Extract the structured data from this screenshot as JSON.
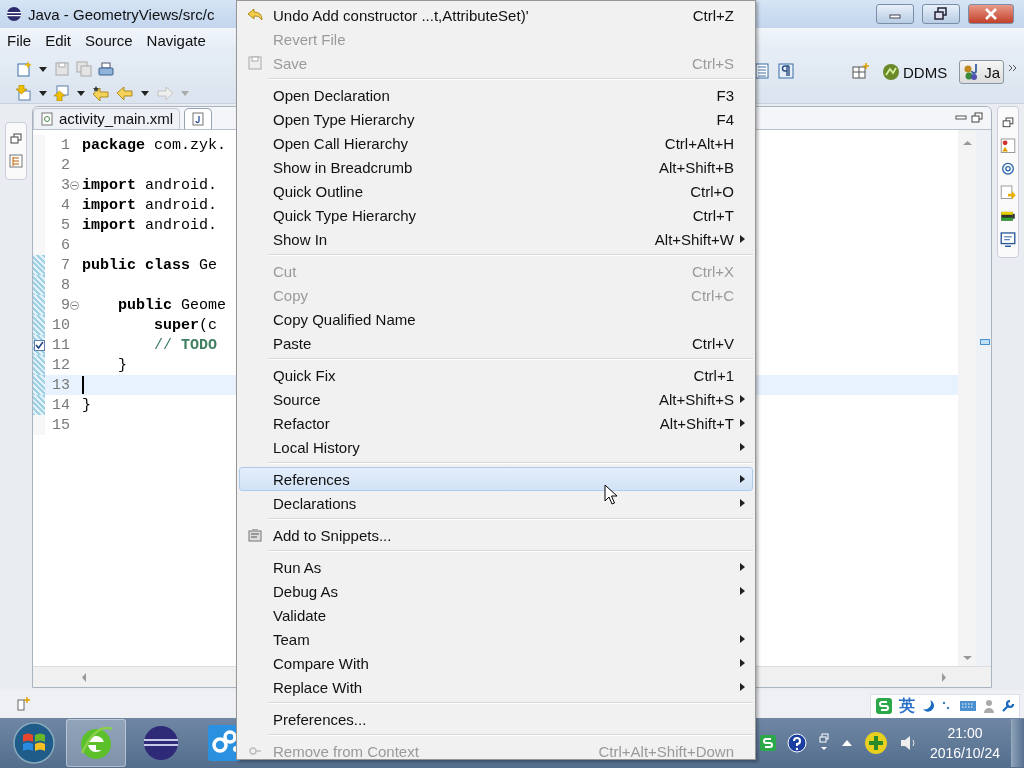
{
  "window": {
    "title": "Java - GeometryViews/src/c"
  },
  "menubar": [
    "File",
    "Edit",
    "Source",
    "Navigate"
  ],
  "perspectives": [
    {
      "label": "DDMS",
      "selected": false
    },
    {
      "label": "Ja",
      "selected": true
    }
  ],
  "editor": {
    "tabs": [
      {
        "label": "activity_main.xml",
        "selected": false
      },
      {
        "selected": true
      }
    ],
    "lines": [
      {
        "number": "1",
        "text": "**package** com.zyk.",
        "kind": "code",
        "folding": false,
        "task": false,
        "current": false,
        "changed": false
      },
      {
        "number": "2",
        "folding": false,
        "task": false,
        "current": false,
        "changed": false
      },
      {
        "number": "3",
        "text": "**import** android.",
        "kind": "code",
        "folding": true,
        "task": false,
        "current": false,
        "changed": false
      },
      {
        "number": "4",
        "text": "**import** android.",
        "kind": "code",
        "folding": false,
        "task": false,
        "current": false,
        "changed": false
      },
      {
        "number": "5",
        "text": "**import** android.",
        "kind": "code",
        "folding": false,
        "task": false,
        "current": false,
        "changed": false
      },
      {
        "number": "6",
        "folding": false,
        "task": false,
        "current": false,
        "changed": false
      },
      {
        "number": "7",
        "text": "**public class** Ge",
        "kind": "code",
        "folding": false,
        "task": false,
        "current": false,
        "changed": true
      },
      {
        "number": "8",
        "folding": false,
        "task": false,
        "current": false,
        "changed": true
      },
      {
        "number": "9",
        "text": "    **public** Geome",
        "kind": "code",
        "folding": true,
        "task": false,
        "current": false,
        "changed": true
      },
      {
        "number": "10",
        "text": "        **super**(c",
        "kind": "code",
        "folding": false,
        "task": false,
        "current": false,
        "changed": true
      },
      {
        "number": "11",
        "text": "        // **TODO**",
        "kind": "comment",
        "folding": false,
        "task": true,
        "current": false,
        "changed": true
      },
      {
        "number": "12",
        "text": "    }",
        "kind": "code",
        "folding": false,
        "task": false,
        "current": false,
        "changed": true
      },
      {
        "number": "13",
        "folding": false,
        "task": false,
        "current": true,
        "changed": true
      },
      {
        "number": "14",
        "text": "}",
        "kind": "code",
        "folding": false,
        "task": false,
        "current": false,
        "changed": true
      },
      {
        "number": "15",
        "folding": false,
        "task": false,
        "current": false,
        "changed": false
      }
    ]
  },
  "context_menu": {
    "items": [
      {
        "kind": "item",
        "label": "Undo Add constructor ...t,AttributeSet)'",
        "shortcut": "Ctrl+Z",
        "submenu": false,
        "disabled": false,
        "selected": false
      },
      {
        "kind": "item",
        "label": "Revert File",
        "submenu": false,
        "disabled": true,
        "selected": false
      },
      {
        "kind": "item",
        "label": "Save",
        "shortcut": "Ctrl+S",
        "submenu": false,
        "disabled": true,
        "selected": false
      },
      {
        "kind": "separator"
      },
      {
        "kind": "item",
        "label": "Open Declaration",
        "shortcut": "F3",
        "submenu": false,
        "disabled": false,
        "selected": false
      },
      {
        "kind": "item",
        "label": "Open Type Hierarchy",
        "shortcut": "F4",
        "submenu": false,
        "disabled": false,
        "selected": false
      },
      {
        "kind": "item",
        "label": "Open Call Hierarchy",
        "shortcut": "Ctrl+Alt+H",
        "submenu": false,
        "disabled": false,
        "selected": false
      },
      {
        "kind": "item",
        "label": "Show in Breadcrumb",
        "shortcut": "Alt+Shift+B",
        "submenu": false,
        "disabled": false,
        "selected": false
      },
      {
        "kind": "item",
        "label": "Quick Outline",
        "shortcut": "Ctrl+O",
        "submenu": false,
        "disabled": false,
        "selected": false
      },
      {
        "kind": "item",
        "label": "Quick Type Hierarchy",
        "shortcut": "Ctrl+T",
        "submenu": false,
        "disabled": false,
        "selected": false
      },
      {
        "kind": "item",
        "label": "Show In",
        "shortcut": "Alt+Shift+W",
        "submenu": true,
        "disabled": false,
        "selected": false
      },
      {
        "kind": "separator"
      },
      {
        "kind": "item",
        "label": "Cut",
        "shortcut": "Ctrl+X",
        "submenu": false,
        "disabled": true,
        "selected": false
      },
      {
        "kind": "item",
        "label": "Copy",
        "shortcut": "Ctrl+C",
        "submenu": false,
        "disabled": true,
        "selected": false
      },
      {
        "kind": "item",
        "label": "Copy Qualified Name",
        "submenu": false,
        "disabled": false,
        "selected": false
      },
      {
        "kind": "item",
        "label": "Paste",
        "shortcut": "Ctrl+V",
        "submenu": false,
        "disabled": false,
        "selected": false
      },
      {
        "kind": "separator"
      },
      {
        "kind": "item",
        "label": "Quick Fix",
        "shortcut": "Ctrl+1",
        "submenu": false,
        "disabled": false,
        "selected": false
      },
      {
        "kind": "item",
        "label": "Source",
        "shortcut": "Alt+Shift+S",
        "submenu": true,
        "disabled": false,
        "selected": false
      },
      {
        "kind": "item",
        "label": "Refactor",
        "shortcut": "Alt+Shift+T",
        "submenu": true,
        "disabled": false,
        "selected": false
      },
      {
        "kind": "item",
        "label": "Local History",
        "submenu": true,
        "disabled": false,
        "selected": false
      },
      {
        "kind": "separator"
      },
      {
        "kind": "item",
        "label": "References",
        "submenu": true,
        "disabled": false,
        "selected": true
      },
      {
        "kind": "item",
        "label": "Declarations",
        "submenu": true,
        "disabled": false,
        "selected": false
      },
      {
        "kind": "separator"
      },
      {
        "kind": "item",
        "label": "Add to Snippets...",
        "submenu": false,
        "disabled": false,
        "selected": false
      },
      {
        "kind": "separator"
      },
      {
        "kind": "item",
        "label": "Run As",
        "submenu": true,
        "disabled": false,
        "selected": false
      },
      {
        "kind": "item",
        "label": "Debug As",
        "submenu": true,
        "disabled": false,
        "selected": false
      },
      {
        "kind": "item",
        "label": "Validate",
        "submenu": false,
        "disabled": false,
        "selected": false
      },
      {
        "kind": "item",
        "label": "Team",
        "submenu": true,
        "disabled": false,
        "selected": false
      },
      {
        "kind": "item",
        "label": "Compare With",
        "submenu": true,
        "disabled": false,
        "selected": false
      },
      {
        "kind": "item",
        "label": "Replace With",
        "submenu": true,
        "disabled": false,
        "selected": false
      },
      {
        "kind": "separator"
      },
      {
        "kind": "item",
        "label": "Preferences...",
        "submenu": false,
        "disabled": false,
        "selected": false
      },
      {
        "kind": "separator"
      },
      {
        "kind": "item",
        "label": "Remove from Context",
        "shortcut": "Ctrl+Alt+Shift+Down",
        "submenu": false,
        "disabled": true,
        "selected": false
      }
    ]
  },
  "input_bar": {
    "language": "英"
  },
  "clock": {
    "time": "21:00",
    "date": "2016/10/24"
  }
}
